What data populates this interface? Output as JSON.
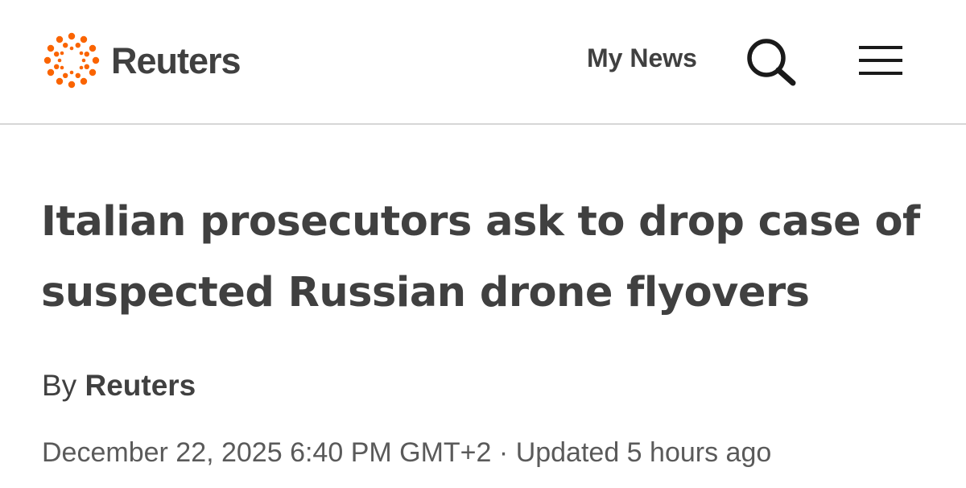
{
  "header": {
    "brand_name": "Reuters",
    "brand_color": "#fa6400",
    "logo_icon": "reuters-dots-logo-icon",
    "my_news_label": "My News",
    "search_icon": "search-icon",
    "menu_icon": "hamburger-menu-icon"
  },
  "article": {
    "headline": "Italian prosecutors ask to drop case of suspected Russian drone flyovers",
    "byline_prefix": "By",
    "author": "Reuters",
    "published": "December 22, 2025 6:40 PM GMT+2",
    "separator": "·",
    "updated": "Updated 5 hours ago"
  }
}
